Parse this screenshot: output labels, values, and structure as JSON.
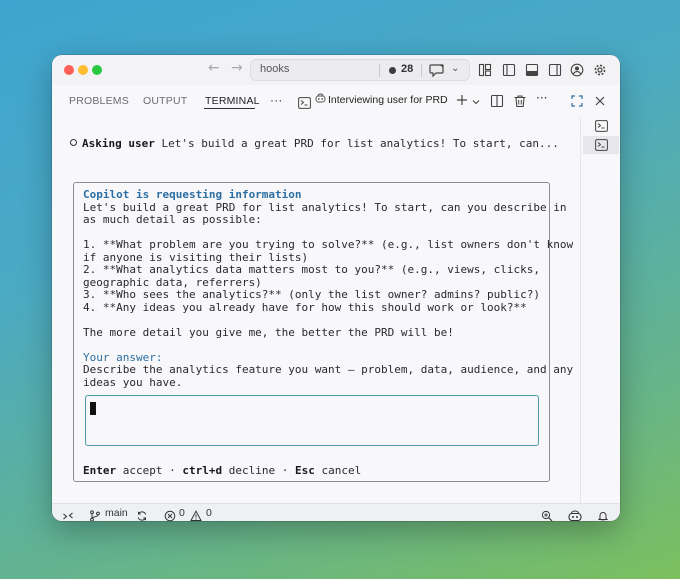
{
  "titlebar": {
    "search_text": "hooks",
    "count": "28"
  },
  "panel": {
    "tabs": [
      {
        "label": "PROBLEMS"
      },
      {
        "label": "OUTPUT"
      },
      {
        "label": "TERMINAL"
      }
    ],
    "active_tab": "TERMINAL",
    "more": "···",
    "terminal_title": "Interviewing user for PRD"
  },
  "terminal": {
    "asking_label": "Asking user",
    "asking_text": "Let's build a great PRD for list analytics! To start, can...",
    "request": {
      "title": "Copilot is requesting information",
      "lines": [
        "Let's build a great PRD for list analytics! To start, can you describe in",
        "as much detail as possible:",
        "",
        "1. **What problem are you trying to solve?** (e.g., list owners don't know",
        "if anyone is visiting their lists)",
        "2. **What analytics data matters most to you?** (e.g., views, clicks,",
        "geographic data, referrers)",
        "3. **Who sees the analytics?** (only the list owner? admins? public?)",
        "4. **Any ideas you already have for how this should work or look?**",
        "",
        "The more detail you give me, the better the PRD will be!"
      ],
      "answer_label": "Your answer:",
      "answer_help": [
        "Describe the analytics feature you want — problem, data, audience, and any",
        "ideas you have."
      ],
      "hints": {
        "enter_key": "Enter",
        "enter_action": "accept",
        "decline_key": "ctrl+d",
        "decline_action": "decline",
        "esc_key": "Esc",
        "esc_action": "cancel",
        "separator": "·"
      }
    }
  },
  "statusbar": {
    "branch": "main",
    "errors": "0",
    "warnings": "0"
  }
}
